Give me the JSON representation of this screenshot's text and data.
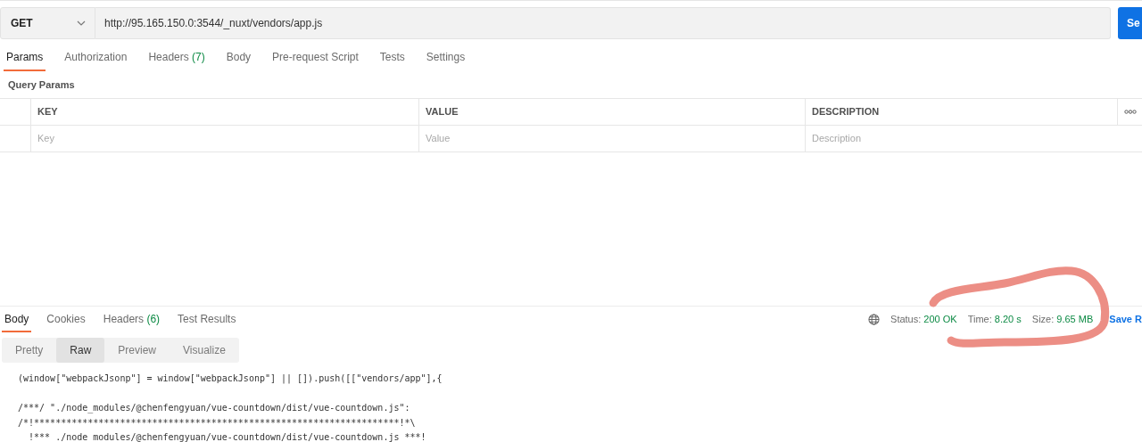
{
  "request": {
    "method": "GET",
    "url": "http://95.165.150.0:3544/_nuxt/vendors/app.js",
    "send_label": "Se"
  },
  "request_tabs": [
    {
      "label": "Params",
      "selected": true
    },
    {
      "label": "Authorization",
      "selected": false
    },
    {
      "label": "Headers",
      "count": "(7)",
      "selected": false
    },
    {
      "label": "Body",
      "selected": false
    },
    {
      "label": "Pre-request Script",
      "selected": false
    },
    {
      "label": "Tests",
      "selected": false
    },
    {
      "label": "Settings",
      "selected": false
    }
  ],
  "query_params": {
    "title": "Query Params",
    "columns": [
      "KEY",
      "VALUE",
      "DESCRIPTION"
    ],
    "row": [
      {
        "placeholder": "Key"
      },
      {
        "placeholder": "Value"
      },
      {
        "placeholder": "Description"
      }
    ]
  },
  "response_tabs": [
    {
      "label": "Body",
      "selected": true
    },
    {
      "label": "Cookies",
      "selected": false
    },
    {
      "label": "Headers",
      "count": "(6)",
      "selected": false
    },
    {
      "label": "Test Results",
      "selected": false
    }
  ],
  "response_meta": [
    {
      "label": "Status:",
      "value": "200 OK"
    },
    {
      "label": "Time:",
      "value": "8.20 s"
    },
    {
      "label": "Size:",
      "value": "9.65 MB"
    }
  ],
  "save_label": "Save R",
  "view_modes": [
    {
      "label": "Pretty",
      "selected": false
    },
    {
      "label": "Raw",
      "selected": true
    },
    {
      "label": "Preview",
      "selected": false
    },
    {
      "label": "Visualize",
      "selected": false
    }
  ],
  "code_blocks": [
    [
      "(window[\"webpackJsonp\"] = window[\"webpackJsonp\"] || []).push([[\"vendors/app\"],{"
    ],
    [
      "/***/ \"./node_modules/@chenfengyuan/vue-countdown/dist/vue-countdown.js\":",
      "/*!********************************************************************!*\\",
      "  !*** ./node_modules/@chenfengyuan/vue-countdown/dist/vue-countdown.js ***!"
    ]
  ],
  "annotation": {
    "color": "#ec8e85"
  }
}
